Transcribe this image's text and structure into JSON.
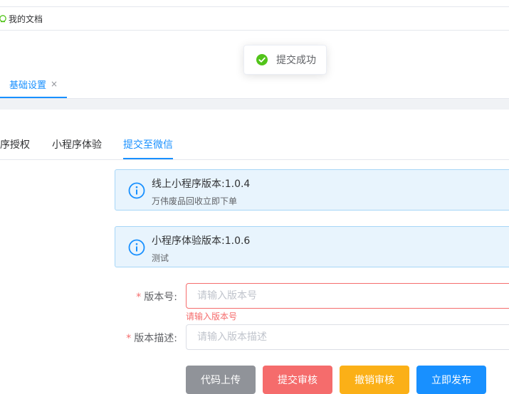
{
  "breadcrumb": {
    "label": "我的文档",
    "icon": "document-icon"
  },
  "toast": {
    "message": "提交成功",
    "icon": "success-check-icon",
    "color": "#52c41a"
  },
  "page_tabs": [
    {
      "label": "基础设置",
      "close": "×",
      "active": true
    }
  ],
  "sub_tabs": [
    {
      "label": "序授权"
    },
    {
      "label": "小程序体验"
    },
    {
      "label": "提交至微信",
      "active": true
    }
  ],
  "alerts": [
    {
      "title": "线上小程序版本:1.0.4",
      "desc": "万伟废品回收立即下单"
    },
    {
      "title": "小程序体验版本:1.0.6",
      "desc": "测试"
    }
  ],
  "form": {
    "version": {
      "required_mark": "*",
      "label": "版本号:",
      "placeholder": "请输入版本号",
      "value": "",
      "error": "请输入版本号"
    },
    "description": {
      "required_mark": "*",
      "label": "版本描述:",
      "placeholder": "请输入版本描述",
      "value": ""
    }
  },
  "buttons": {
    "upload": {
      "label": "代码上传",
      "color": "#909399"
    },
    "submit_review": {
      "label": "提交审核",
      "color": "#f56c6c"
    },
    "revoke_review": {
      "label": "撤销审核",
      "color": "#fbb017"
    },
    "publish": {
      "label": "立即发布",
      "color": "#1890ff"
    }
  },
  "colors": {
    "accent": "#1890ff",
    "error": "#f56c6c",
    "info_bg": "#e8f4fd",
    "info_border": "#a6d6f7"
  }
}
